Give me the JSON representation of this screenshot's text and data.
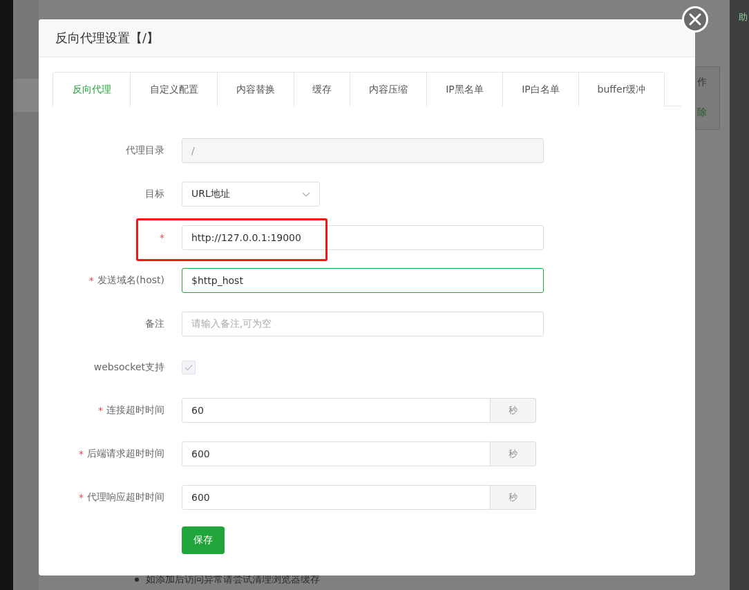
{
  "background": {
    "top_right_fragment": "助",
    "table_fragment": {
      "header": "作",
      "action": "除"
    },
    "notice": "如添加后访问异常请尝试清理浏览器缓存"
  },
  "dialog": {
    "title": "反向代理设置【/】",
    "tabs": [
      {
        "label": "反向代理",
        "selected": true
      },
      {
        "label": "自定义配置",
        "selected": false
      },
      {
        "label": "内容替换",
        "selected": false
      },
      {
        "label": "缓存",
        "selected": false
      },
      {
        "label": "内容压缩",
        "selected": false
      },
      {
        "label": "IP黑名单",
        "selected": false
      },
      {
        "label": "IP白名单",
        "selected": false
      },
      {
        "label": "buffer缓冲",
        "selected": false
      }
    ],
    "required_mark": "*",
    "fields": [
      {
        "kind": "readonly",
        "label": "代理目录",
        "required": false,
        "value": "/"
      },
      {
        "kind": "select",
        "label": "目标",
        "required": false,
        "value": "URL地址"
      },
      {
        "kind": "text",
        "required": true,
        "value": "http://127.0.0.1:19000",
        "highlighted": true,
        "focused": false
      },
      {
        "kind": "text",
        "label": "发送域名(host)",
        "required": true,
        "value": "$http_host",
        "highlighted": false,
        "focused": true
      },
      {
        "kind": "text",
        "label": "备注",
        "required": false,
        "placeholder": "请输入备注,可为空",
        "highlighted": false,
        "focused": false
      },
      {
        "kind": "checkbox",
        "label": "websocket支持",
        "required": false,
        "checked": true,
        "disabled": true
      },
      {
        "kind": "unit",
        "label": "连接超时时间",
        "required": true,
        "value": "60",
        "unit": "秒"
      },
      {
        "kind": "unit",
        "label": "后端请求超时时间",
        "required": true,
        "value": "600",
        "unit": "秒"
      },
      {
        "kind": "unit",
        "label": "代理响应超时时间",
        "required": true,
        "value": "600",
        "unit": "秒"
      }
    ],
    "save_button": "保存"
  }
}
